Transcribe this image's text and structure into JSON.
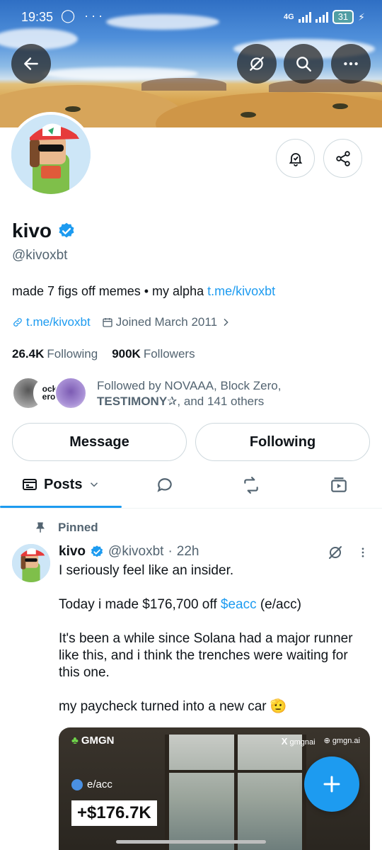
{
  "status_bar": {
    "time": "19:35",
    "left_icons": "◯ ···",
    "network": "4G",
    "battery": "31"
  },
  "profile": {
    "name": "kivo",
    "handle": "@kivoxbt",
    "bio_text": "made 7 figs off memes • my alpha ",
    "bio_link": "t.me/kivoxbt",
    "website": "t.me/kivoxbt",
    "joined": "Joined March 2011",
    "following_count": "26.4K",
    "following_label": "Following",
    "followers_count": "900K",
    "followers_label": "Followers",
    "followed_by_line1": "Followed by NOVAAA, Block Zero,",
    "followed_by_name3": "TESTIMONY",
    "followed_by_star": "✰",
    "followed_by_rest": ", and 141 others",
    "mini_avatar_text": "ock\nero"
  },
  "actions": {
    "message": "Message",
    "following": "Following"
  },
  "tabs": {
    "posts": "Posts"
  },
  "post": {
    "pinned_label": "Pinned",
    "name": "kivo",
    "handle": "@kivoxbt",
    "dot": "·",
    "time": "22h",
    "line1": "I seriously feel like an insider.",
    "line2_pre": "Today i made $176,700 off ",
    "line2_tag": "$eacc",
    "line2_post": " (e/acc)",
    "line3": "It's been a while since Solana had a major runner like this, and i think the trenches were waiting for this one.",
    "line4": "my paycheck turned into a new car 🫡"
  },
  "card": {
    "brand": "GMGN",
    "x_handle": "gmgnai",
    "site": "gmgn.ai",
    "ticker": "e/acc",
    "gain": "+$176.7K"
  },
  "colors": {
    "accent": "#1d9bf0",
    "text": "#0f1419",
    "muted": "#536471",
    "border": "#cfd9de"
  }
}
